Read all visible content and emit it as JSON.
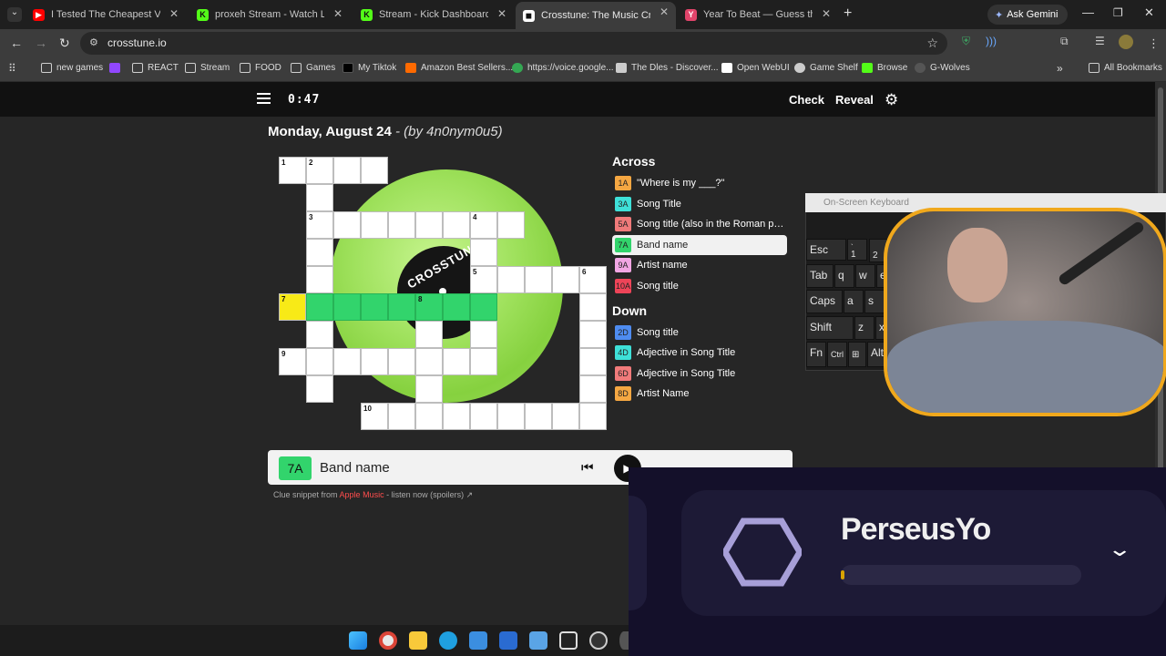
{
  "browser": {
    "tabs": [
      {
        "title": "I Tested The Cheapest VS Most",
        "icon": "youtube-icon",
        "color": "#ff0000"
      },
      {
        "title": "proxeh Stream - Watch Live on",
        "icon": "kick-icon",
        "color": "#53fc18"
      },
      {
        "title": "Stream - Kick Dashboard",
        "icon": "kick-icon",
        "color": "#53fc18"
      },
      {
        "title": "Crosstune: The Music Crosswo",
        "icon": "crosstune-icon",
        "color": "#ffffff",
        "active": true
      },
      {
        "title": "Year To Beat — Guess the Song",
        "icon": "yeartobeat-icon",
        "color": "#e0446a"
      }
    ],
    "new_tab": "+",
    "ask_gemini": "Ask Gemini",
    "url": "crosstune.io",
    "bookmarks": [
      "new games",
      "REACT",
      "Stream",
      "FOOD",
      "Games",
      "My Tiktok",
      "Amazon Best Sellers...",
      "https://voice.google...",
      "The Dles - Discover...",
      "Open WebUI",
      "Game Shelf",
      "Browse",
      "G-Wolves"
    ],
    "all_bookmarks": "All Bookmarks"
  },
  "app": {
    "timer": "0:47",
    "check": "Check",
    "reveal": "Reveal",
    "date": "Monday, August 24",
    "byline": " - (by 4n0nym0u5)",
    "vinyl_text": "CROSSTUNE"
  },
  "clues": {
    "across_title": "Across",
    "down_title": "Down",
    "across": [
      {
        "num": "1A",
        "text": "\"Where is my ___?\"",
        "color": "#f5a742"
      },
      {
        "num": "3A",
        "text": "Song Title",
        "color": "#3ee0d8"
      },
      {
        "num": "5A",
        "text": "Song title (also in the Roman pan...",
        "color": "#f07a7a"
      },
      {
        "num": "7A",
        "text": "Band name",
        "color": "#32d46c",
        "selected": true
      },
      {
        "num": "9A",
        "text": "Artist name",
        "color": "#f2a6e4"
      },
      {
        "num": "10A",
        "text": "Song title",
        "color": "#ee4458"
      }
    ],
    "down": [
      {
        "num": "2D",
        "text": "Song title",
        "color": "#4e8cf0"
      },
      {
        "num": "4D",
        "text": "Adjective in Song Title",
        "color": "#3ee0d8"
      },
      {
        "num": "6D",
        "text": "Adjective in Song Title",
        "color": "#f07a7a"
      },
      {
        "num": "8D",
        "text": "Artist Name",
        "color": "#f5a742"
      }
    ]
  },
  "cluebar": {
    "num": "7A",
    "text": "Band name"
  },
  "snippet": {
    "prefix": "Clue snippet from ",
    "source": "Apple Music",
    "suffix": " - listen now (spoilers) ↗"
  },
  "osk": {
    "title": "On-Screen Keyboard",
    "keys": [
      "Esc",
      "`",
      "1",
      "2",
      "Tab",
      "q",
      "w",
      "e",
      "Caps",
      "a",
      "s",
      "Shift",
      "z",
      "x",
      "Fn",
      "Ctrl",
      "⊞",
      "Alt"
    ]
  },
  "overlay": {
    "username": "PerseusYo",
    "progress": 0.01
  },
  "grid": {
    "numbers": {
      "1": "1",
      "2": "2",
      "3": "3",
      "4": "4",
      "5": "5",
      "6": "6",
      "7": "7",
      "8": "8",
      "9": "9",
      "10": "10"
    }
  }
}
